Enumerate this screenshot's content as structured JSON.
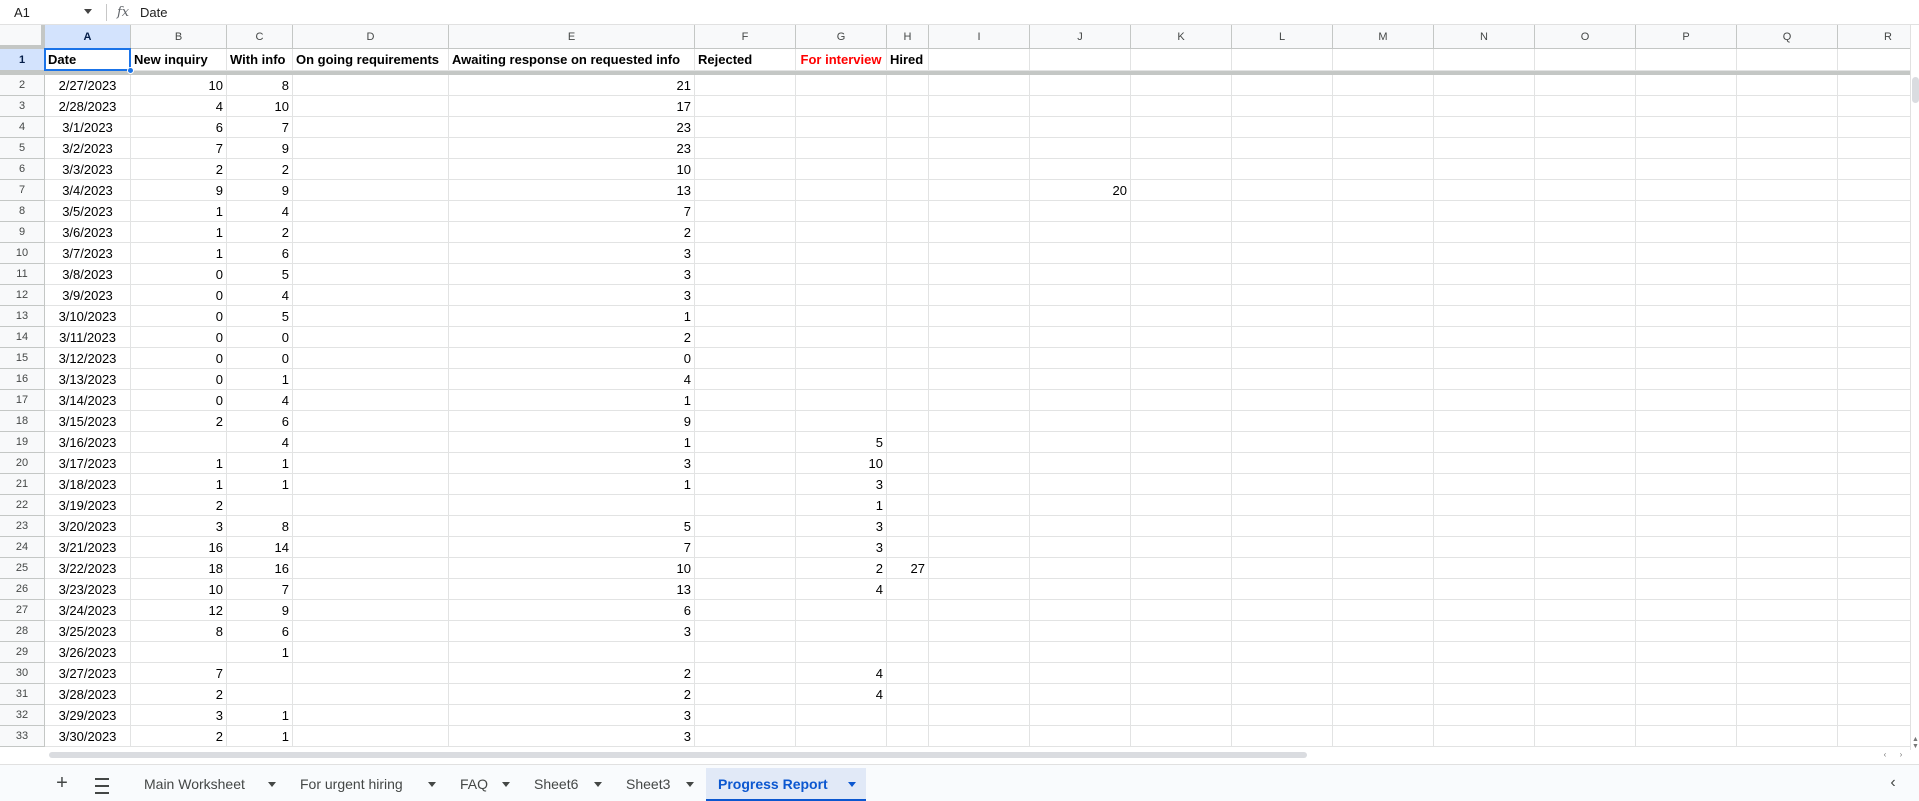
{
  "formula_bar": {
    "name_box": "A1",
    "fx_label": "fx",
    "formula_value": "Date"
  },
  "columns": [
    "A",
    "B",
    "C",
    "D",
    "E",
    "F",
    "G",
    "H",
    "I",
    "J",
    "K",
    "L",
    "M",
    "N",
    "O",
    "P",
    "Q",
    "R"
  ],
  "header_row": {
    "row_number": "1",
    "cells": [
      "Date",
      "New inquiry",
      "With info",
      "On going requirements",
      "Awaiting response on requested info",
      "Rejected",
      "For interview",
      "Hired"
    ]
  },
  "rows": [
    {
      "n": "2",
      "date": "2/27/2023",
      "b": "10",
      "c": "8",
      "d": "",
      "e": "21",
      "f": "",
      "g": "",
      "h": "",
      "j": ""
    },
    {
      "n": "3",
      "date": "2/28/2023",
      "b": "4",
      "c": "10",
      "d": "",
      "e": "17",
      "f": "",
      "g": "",
      "h": "",
      "j": ""
    },
    {
      "n": "4",
      "date": "3/1/2023",
      "b": "6",
      "c": "7",
      "d": "",
      "e": "23",
      "f": "",
      "g": "",
      "h": "",
      "j": ""
    },
    {
      "n": "5",
      "date": "3/2/2023",
      "b": "7",
      "c": "9",
      "d": "",
      "e": "23",
      "f": "",
      "g": "",
      "h": "",
      "j": ""
    },
    {
      "n": "6",
      "date": "3/3/2023",
      "b": "2",
      "c": "2",
      "d": "",
      "e": "10",
      "f": "",
      "g": "",
      "h": "",
      "j": ""
    },
    {
      "n": "7",
      "date": "3/4/2023",
      "b": "9",
      "c": "9",
      "d": "",
      "e": "13",
      "f": "",
      "g": "",
      "h": "",
      "j": "20"
    },
    {
      "n": "8",
      "date": "3/5/2023",
      "b": "1",
      "c": "4",
      "d": "",
      "e": "7",
      "f": "",
      "g": "",
      "h": "",
      "j": ""
    },
    {
      "n": "9",
      "date": "3/6/2023",
      "b": "1",
      "c": "2",
      "d": "",
      "e": "2",
      "f": "",
      "g": "",
      "h": "",
      "j": ""
    },
    {
      "n": "10",
      "date": "3/7/2023",
      "b": "1",
      "c": "6",
      "d": "",
      "e": "3",
      "f": "",
      "g": "",
      "h": "",
      "j": ""
    },
    {
      "n": "11",
      "date": "3/8/2023",
      "b": "0",
      "c": "5",
      "d": "",
      "e": "3",
      "f": "",
      "g": "",
      "h": "",
      "j": ""
    },
    {
      "n": "12",
      "date": "3/9/2023",
      "b": "0",
      "c": "4",
      "d": "",
      "e": "3",
      "f": "",
      "g": "",
      "h": "",
      "j": ""
    },
    {
      "n": "13",
      "date": "3/10/2023",
      "b": "0",
      "c": "5",
      "d": "",
      "e": "1",
      "f": "",
      "g": "",
      "h": "",
      "j": ""
    },
    {
      "n": "14",
      "date": "3/11/2023",
      "b": "0",
      "c": "0",
      "d": "",
      "e": "2",
      "f": "",
      "g": "",
      "h": "",
      "j": ""
    },
    {
      "n": "15",
      "date": "3/12/2023",
      "b": "0",
      "c": "0",
      "d": "",
      "e": "0",
      "f": "",
      "g": "",
      "h": "",
      "j": ""
    },
    {
      "n": "16",
      "date": "3/13/2023",
      "b": "0",
      "c": "1",
      "d": "",
      "e": "4",
      "f": "",
      "g": "",
      "h": "",
      "j": ""
    },
    {
      "n": "17",
      "date": "3/14/2023",
      "b": "0",
      "c": "4",
      "d": "",
      "e": "1",
      "f": "",
      "g": "",
      "h": "",
      "j": ""
    },
    {
      "n": "18",
      "date": "3/15/2023",
      "b": "2",
      "c": "6",
      "d": "",
      "e": "9",
      "f": "",
      "g": "",
      "h": "",
      "j": ""
    },
    {
      "n": "19",
      "date": "3/16/2023",
      "b": "",
      "c": "4",
      "d": "",
      "e": "1",
      "f": "",
      "g": "5",
      "h": "",
      "j": ""
    },
    {
      "n": "20",
      "date": "3/17/2023",
      "b": "1",
      "c": "1",
      "d": "",
      "e": "3",
      "f": "",
      "g": "10",
      "h": "",
      "j": ""
    },
    {
      "n": "21",
      "date": "3/18/2023",
      "b": "1",
      "c": "1",
      "d": "",
      "e": "1",
      "f": "",
      "g": "3",
      "h": "",
      "j": ""
    },
    {
      "n": "22",
      "date": "3/19/2023",
      "b": "2",
      "c": "",
      "d": "",
      "e": "",
      "f": "",
      "g": "1",
      "h": "",
      "j": ""
    },
    {
      "n": "23",
      "date": "3/20/2023",
      "b": "3",
      "c": "8",
      "d": "",
      "e": "5",
      "f": "",
      "g": "3",
      "h": "",
      "j": ""
    },
    {
      "n": "24",
      "date": "3/21/2023",
      "b": "16",
      "c": "14",
      "d": "",
      "e": "7",
      "f": "",
      "g": "3",
      "h": "",
      "j": ""
    },
    {
      "n": "25",
      "date": "3/22/2023",
      "b": "18",
      "c": "16",
      "d": "",
      "e": "10",
      "f": "",
      "g": "2",
      "h": "27",
      "j": ""
    },
    {
      "n": "26",
      "date": "3/23/2023",
      "b": "10",
      "c": "7",
      "d": "",
      "e": "13",
      "f": "",
      "g": "4",
      "h": "",
      "j": ""
    },
    {
      "n": "27",
      "date": "3/24/2023",
      "b": "12",
      "c": "9",
      "d": "",
      "e": "6",
      "f": "",
      "g": "",
      "h": "",
      "j": ""
    },
    {
      "n": "28",
      "date": "3/25/2023",
      "b": "8",
      "c": "6",
      "d": "",
      "e": "3",
      "f": "",
      "g": "",
      "h": "",
      "j": ""
    },
    {
      "n": "29",
      "date": "3/26/2023",
      "b": "",
      "c": "1",
      "d": "",
      "e": "",
      "f": "",
      "g": "",
      "h": "",
      "j": ""
    },
    {
      "n": "30",
      "date": "3/27/2023",
      "b": "7",
      "c": "",
      "d": "",
      "e": "2",
      "f": "",
      "g": "4",
      "h": "",
      "j": ""
    },
    {
      "n": "31",
      "date": "3/28/2023",
      "b": "2",
      "c": "",
      "d": "",
      "e": "2",
      "f": "",
      "g": "4",
      "h": "",
      "j": ""
    },
    {
      "n": "32",
      "date": "3/29/2023",
      "b": "3",
      "c": "1",
      "d": "",
      "e": "3",
      "f": "",
      "g": "",
      "h": "",
      "j": ""
    },
    {
      "n": "33",
      "date": "3/30/2023",
      "b": "2",
      "c": "1",
      "d": "",
      "e": "3",
      "f": "",
      "g": "",
      "h": "",
      "j": ""
    }
  ],
  "sheet_tabs": {
    "add_label": "+",
    "tabs": [
      {
        "label": "Main Worksheet",
        "active": false
      },
      {
        "label": "For urgent hiring",
        "active": false
      },
      {
        "label": "FAQ",
        "active": false
      },
      {
        "label": "Sheet6",
        "active": false
      },
      {
        "label": "Sheet3",
        "active": false
      },
      {
        "label": "Progress Report",
        "active": true
      }
    ],
    "collapse_label": "‹"
  },
  "colors": {
    "selection": "#1a73e8",
    "for_interview_header": "#ff0000",
    "active_tab": "#0b57d0"
  }
}
